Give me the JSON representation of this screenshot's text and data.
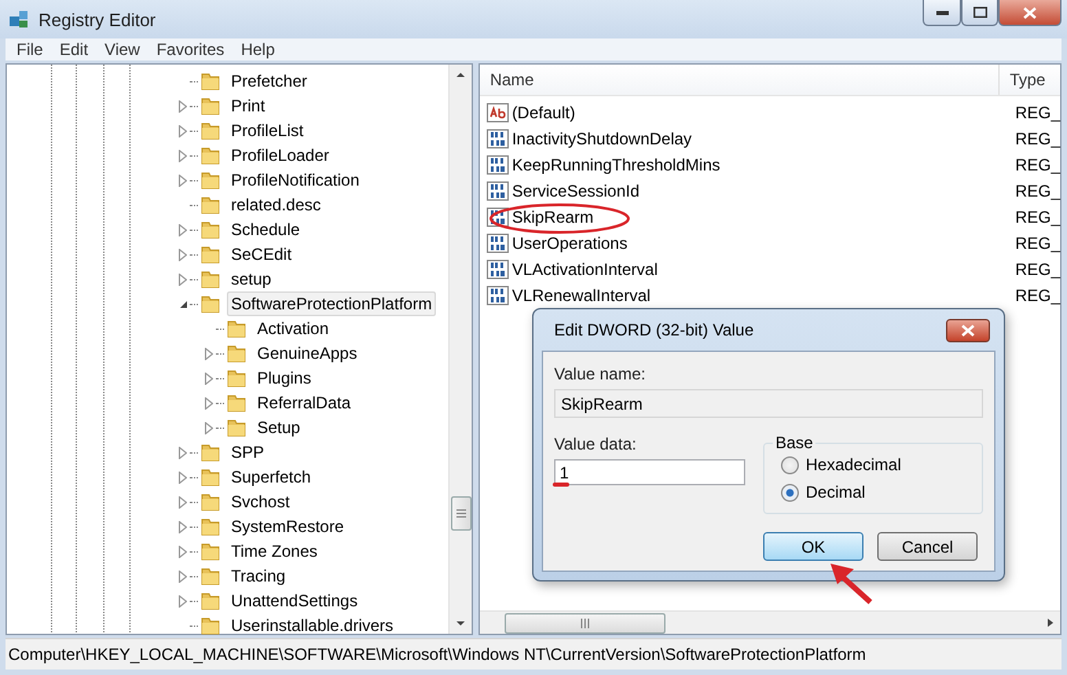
{
  "window": {
    "title": "Registry Editor"
  },
  "menu": [
    "File",
    "Edit",
    "View",
    "Favorites",
    "Help"
  ],
  "tree": [
    {
      "label": "Prefetcher",
      "kind": "leaf",
      "selected": false
    },
    {
      "label": "Print",
      "kind": "collapsed",
      "selected": false
    },
    {
      "label": "ProfileList",
      "kind": "collapsed",
      "selected": false
    },
    {
      "label": "ProfileLoader",
      "kind": "collapsed",
      "selected": false
    },
    {
      "label": "ProfileNotification",
      "kind": "collapsed",
      "selected": false
    },
    {
      "label": "related.desc",
      "kind": "leaf",
      "selected": false
    },
    {
      "label": "Schedule",
      "kind": "collapsed",
      "selected": false
    },
    {
      "label": "SeCEdit",
      "kind": "collapsed",
      "selected": false
    },
    {
      "label": "setup",
      "kind": "collapsed",
      "selected": false
    },
    {
      "label": "SoftwareProtectionPlatform",
      "kind": "expanded",
      "selected": true,
      "children": [
        {
          "label": "Activation",
          "kind": "leaf",
          "selected": false
        },
        {
          "label": "GenuineApps",
          "kind": "collapsed",
          "selected": false
        },
        {
          "label": "Plugins",
          "kind": "collapsed",
          "selected": false
        },
        {
          "label": "ReferralData",
          "kind": "collapsed",
          "selected": false
        },
        {
          "label": "Setup",
          "kind": "collapsed",
          "selected": false
        }
      ]
    },
    {
      "label": "SPP",
      "kind": "collapsed",
      "selected": false
    },
    {
      "label": "Superfetch",
      "kind": "collapsed",
      "selected": false
    },
    {
      "label": "Svchost",
      "kind": "collapsed",
      "selected": false
    },
    {
      "label": "SystemRestore",
      "kind": "collapsed",
      "selected": false
    },
    {
      "label": "Time Zones",
      "kind": "collapsed",
      "selected": false
    },
    {
      "label": "Tracing",
      "kind": "collapsed",
      "selected": false
    },
    {
      "label": "UnattendSettings",
      "kind": "collapsed",
      "selected": false
    },
    {
      "label": "Userinstallable.drivers",
      "kind": "leaf",
      "selected": false
    }
  ],
  "values": {
    "columns": [
      "Name",
      "Type"
    ],
    "rows": [
      {
        "kind": "string",
        "name": "(Default)",
        "type": "REG_"
      },
      {
        "kind": "dword",
        "name": "InactivityShutdownDelay",
        "type": "REG_"
      },
      {
        "kind": "dword",
        "name": "KeepRunningThresholdMins",
        "type": "REG_"
      },
      {
        "kind": "dword",
        "name": "ServiceSessionId",
        "type": "REG_"
      },
      {
        "kind": "dword",
        "name": "SkipRearm",
        "type": "REG_"
      },
      {
        "kind": "dword",
        "name": "UserOperations",
        "type": "REG_"
      },
      {
        "kind": "dword",
        "name": "VLActivationInterval",
        "type": "REG_"
      },
      {
        "kind": "dword",
        "name": "VLRenewalInterval",
        "type": "REG_"
      }
    ]
  },
  "dialog": {
    "title": "Edit DWORD (32-bit) Value",
    "value_name_label": "Value name:",
    "value_name": "SkipRearm",
    "value_data_label": "Value data:",
    "value_data": "1",
    "base": {
      "label": "Base",
      "options": [
        {
          "label": "Hexadecimal",
          "selected": false
        },
        {
          "label": "Decimal",
          "selected": true
        }
      ]
    },
    "buttons": [
      {
        "label": "OK",
        "focused": true
      },
      {
        "label": "Cancel",
        "focused": false
      }
    ]
  },
  "status_bar": "Computer\\HKEY_LOCAL_MACHINE\\SOFTWARE\\Microsoft\\Windows NT\\CurrentVersion\\SoftwareProtectionPlatform"
}
